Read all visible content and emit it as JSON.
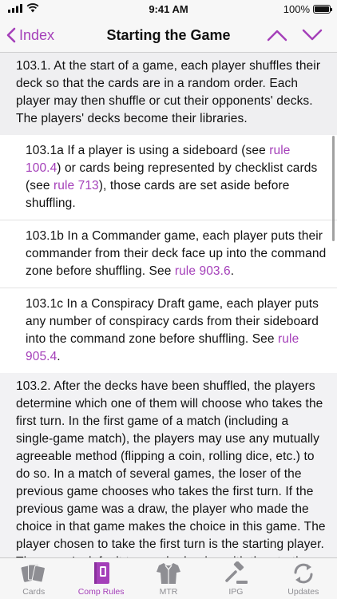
{
  "status_bar": {
    "time": "9:41 AM",
    "battery_level": "100%",
    "icons": [
      "signal-icon",
      "wifi-icon",
      "battery-icon"
    ]
  },
  "nav": {
    "back_label": "Index",
    "title": "Starting the Game",
    "icons": [
      "chevron-left-icon",
      "chevron-up-icon",
      "chevron-down-icon"
    ]
  },
  "rules": {
    "r103_1": {
      "text": "103.1. At the start of a game, each player shuffles their deck so that the cards are in a random order. Each player may then shuffle or cut their opponents' decks. The players' decks become their libraries."
    },
    "r103_1a": {
      "text_a": "103.1a If a player is using a sideboard (see ",
      "link_1": "rule 100.4",
      "text_b": ") or cards being represented by checklist cards (see ",
      "link_2": "rule 713",
      "text_c": "), those cards are set aside before shuffling."
    },
    "r103_1b": {
      "text_a": "103.1b In a Commander game, each player puts their commander from their deck face up into the command zone before shuffling. See ",
      "link_1": "rule 903.6",
      "text_b": "."
    },
    "r103_1c": {
      "text_a": "103.1c In a Conspiracy Draft game, each player puts any number of conspiracy cards from their sideboard into the command zone before shuffling. See ",
      "link_1": "rule 905.4",
      "text_b": "."
    },
    "r103_2": {
      "text": "103.2. After the decks have been shuffled, the players determine which one of them will choose who takes the first turn. In the first game of a match (including a single-game match), the players may use any mutually agreeable method (flipping a coin, rolling dice, etc.) to do so. In a match of several games, the loser of the previous game chooses who takes the first turn. If the previous game was a draw, the player who made the choice in that game makes the choice in this game. The player chosen to take the first turn is the starting player. The game's default turn order begins with the starting player and proceeds clockwise."
    }
  },
  "tabs": [
    {
      "label": "Cards",
      "icon": "cards-icon",
      "active": false
    },
    {
      "label": "Comp Rules",
      "icon": "rulebook-icon",
      "active": true
    },
    {
      "label": "MTR",
      "icon": "shirt-icon",
      "active": false
    },
    {
      "label": "IPG",
      "icon": "gavel-icon",
      "active": false
    },
    {
      "label": "Updates",
      "icon": "refresh-icon",
      "active": false
    }
  ],
  "colors": {
    "accent": "#a43fb9",
    "inactive": "#8e8e93",
    "main_rule_bg": "#efeff1"
  }
}
